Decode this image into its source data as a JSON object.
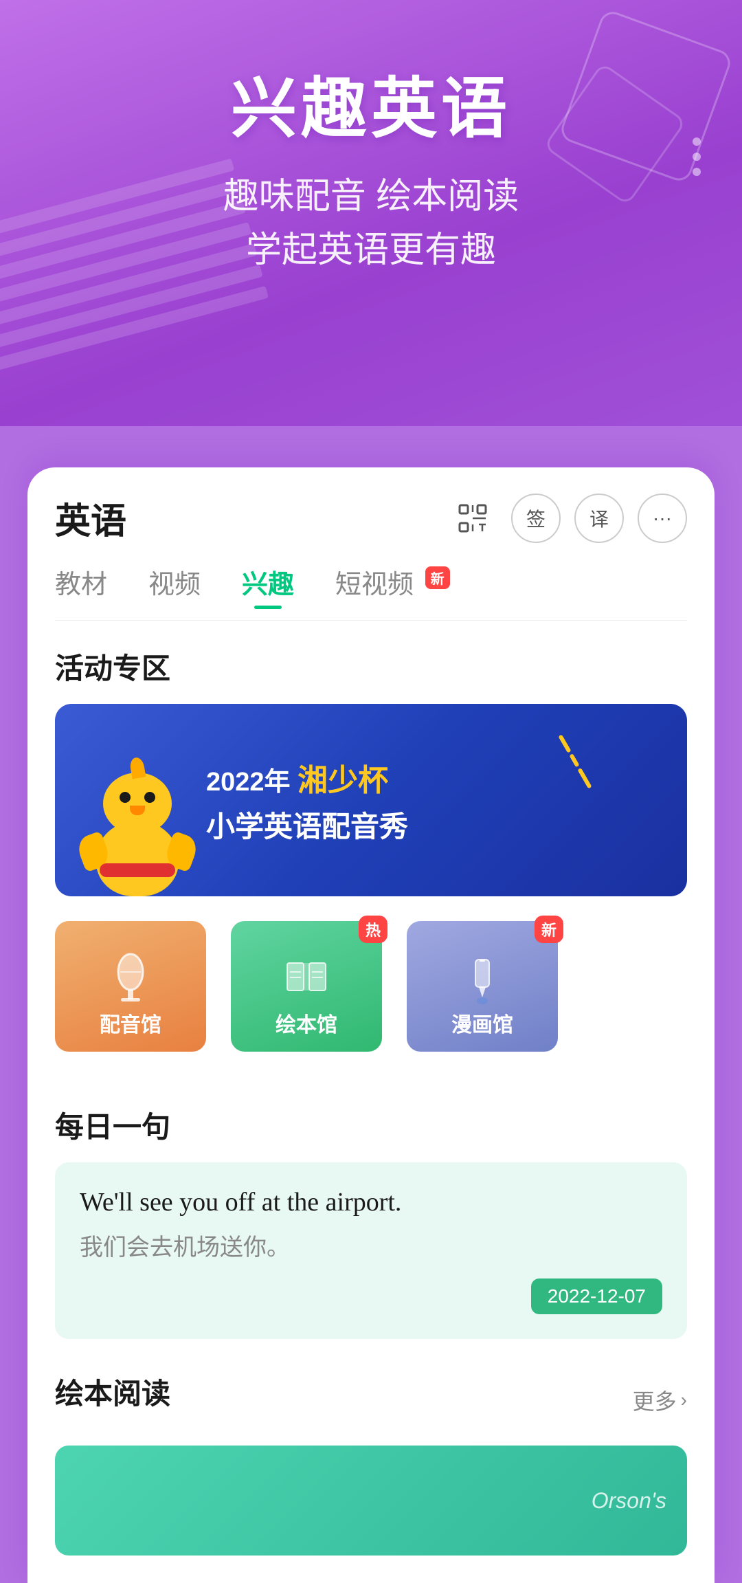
{
  "header": {
    "main_title": "兴趣英语",
    "sub_title_line1": "趣味配音 绘本阅读",
    "sub_title_line2": "学起英语更有趣"
  },
  "card": {
    "title": "英语",
    "icons": {
      "scan": "⬜",
      "sign": "签",
      "translate": "译",
      "more": "···"
    },
    "tabs": [
      {
        "label": "教材",
        "active": false
      },
      {
        "label": "视频",
        "active": false
      },
      {
        "label": "兴趣",
        "active": true
      },
      {
        "label": "短视频",
        "active": false,
        "badge": "新"
      }
    ],
    "activity_section": {
      "title": "活动专区",
      "banner": {
        "year": "2022年",
        "highlight": "湘少杯",
        "subtitle": "小学英语配音秀"
      },
      "categories": [
        {
          "label": "配音馆",
          "type": "dubbing"
        },
        {
          "label": "绘本馆",
          "type": "picture",
          "badge": "热"
        },
        {
          "label": "漫画馆",
          "type": "comic",
          "badge": "新"
        }
      ]
    },
    "daily_section": {
      "title": "每日一句",
      "english": "We'll see you off at the airport.",
      "chinese": "我们会去机场送你。",
      "date": "2022-12-07"
    },
    "picture_book_section": {
      "title": "绘本阅读",
      "more_label": "更多",
      "orson_label": "Orson's"
    }
  }
}
